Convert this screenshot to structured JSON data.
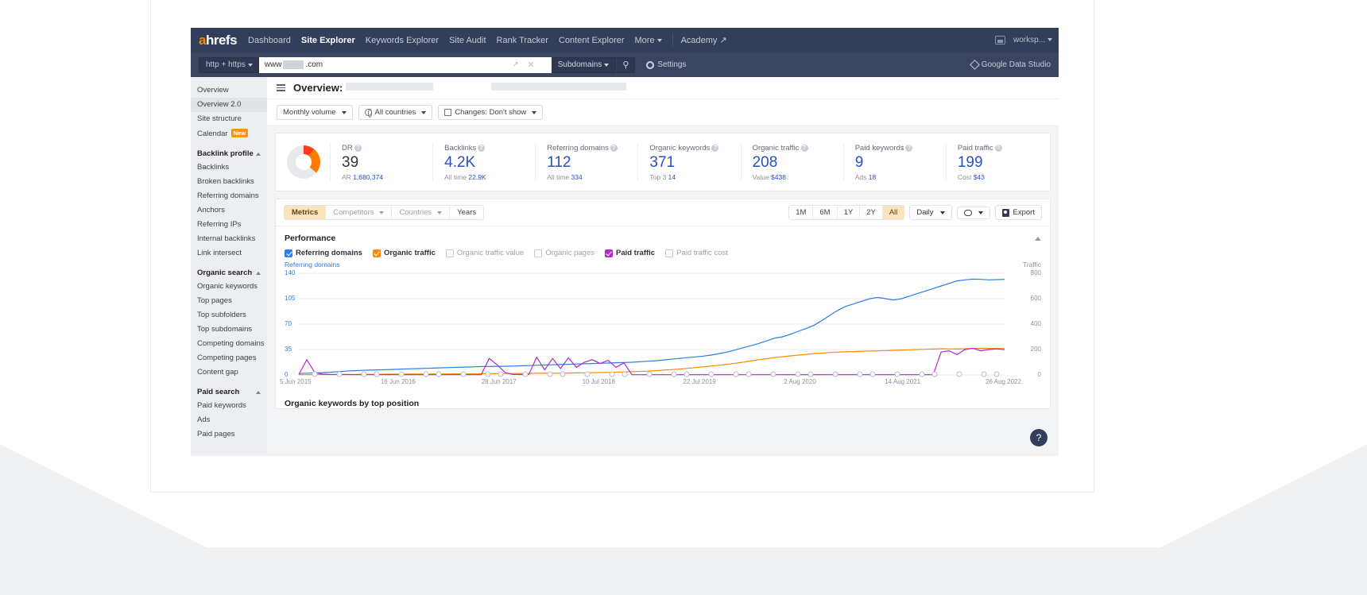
{
  "topnav": {
    "logo": "ahrefs",
    "items": [
      {
        "label": "Dashboard",
        "active": false
      },
      {
        "label": "Site Explorer",
        "active": true
      },
      {
        "label": "Keywords Explorer",
        "active": false
      },
      {
        "label": "Site Audit",
        "active": false
      },
      {
        "label": "Rank Tracker",
        "active": false
      },
      {
        "label": "Content Explorer",
        "active": false
      },
      {
        "label": "More",
        "active": false
      }
    ],
    "academy": "Academy",
    "workspace": "worksp..."
  },
  "searchbar": {
    "protocol": "http + https",
    "value_prefix": "www",
    "value_suffix": ".com",
    "scope": "Subdomains",
    "settings": "Settings",
    "data_studio": "Google Data Studio"
  },
  "sidebar": {
    "items": [
      {
        "label": "Overview",
        "type": "item",
        "selected": false
      },
      {
        "label": "Overview 2.0",
        "type": "item",
        "selected": true
      },
      {
        "label": "Site structure",
        "type": "item",
        "selected": false
      },
      {
        "label": "Calendar",
        "type": "item",
        "selected": false,
        "badge": "New"
      },
      {
        "label": "Backlink profile",
        "type": "group"
      },
      {
        "label": "Backlinks",
        "type": "item",
        "selected": false
      },
      {
        "label": "Broken backlinks",
        "type": "item",
        "selected": false
      },
      {
        "label": "Referring domains",
        "type": "item",
        "selected": false
      },
      {
        "label": "Anchors",
        "type": "item",
        "selected": false
      },
      {
        "label": "Referring IPs",
        "type": "item",
        "selected": false
      },
      {
        "label": "Internal backlinks",
        "type": "item",
        "selected": false
      },
      {
        "label": "Link intersect",
        "type": "item",
        "selected": false
      },
      {
        "label": "Organic search",
        "type": "group"
      },
      {
        "label": "Organic keywords",
        "type": "item",
        "selected": false
      },
      {
        "label": "Top pages",
        "type": "item",
        "selected": false
      },
      {
        "label": "Top subfolders",
        "type": "item",
        "selected": false
      },
      {
        "label": "Top subdomains",
        "type": "item",
        "selected": false
      },
      {
        "label": "Competing domains",
        "type": "item",
        "selected": false
      },
      {
        "label": "Competing pages",
        "type": "item",
        "selected": false
      },
      {
        "label": "Content gap",
        "type": "item",
        "selected": false
      },
      {
        "label": "Paid search",
        "type": "group"
      },
      {
        "label": "Paid keywords",
        "type": "item",
        "selected": false
      },
      {
        "label": "Ads",
        "type": "item",
        "selected": false
      },
      {
        "label": "Paid pages",
        "type": "item",
        "selected": false
      }
    ]
  },
  "page": {
    "title": "Overview:"
  },
  "filters": [
    {
      "label": "Monthly volume",
      "icon": null
    },
    {
      "label": "All countries",
      "icon": "globe-icon"
    },
    {
      "label": "Changes: Don't show",
      "icon": "calendar-icon"
    }
  ],
  "metrics": {
    "dr_gauge_value": 39,
    "cards": [
      {
        "label": "DR",
        "value": "39",
        "value_dark": true,
        "sub_label": "AR",
        "sub_value": "1,680,374"
      },
      {
        "label": "Backlinks",
        "value": "4.2K",
        "value_dark": false,
        "sub_label": "All time",
        "sub_value": "22.9K"
      },
      {
        "label": "Referring domains",
        "value": "112",
        "value_dark": false,
        "sub_label": "All time",
        "sub_value": "334"
      },
      {
        "label": "Organic keywords",
        "value": "371",
        "value_dark": false,
        "sub_label": "Top 3",
        "sub_value": "14"
      },
      {
        "label": "Organic traffic",
        "value": "208",
        "value_dark": false,
        "sub_label": "Value",
        "sub_value": "$438"
      },
      {
        "label": "Paid keywords",
        "value": "9",
        "value_dark": false,
        "sub_label": "Ads",
        "sub_value": "18"
      },
      {
        "label": "Paid traffic",
        "value": "199",
        "value_dark": false,
        "sub_label": "Cost",
        "sub_value": "$43"
      }
    ]
  },
  "chart_toolbar": {
    "tabs": [
      {
        "label": "Metrics",
        "state": "active"
      },
      {
        "label": "Competitors",
        "state": "muted",
        "caret": true
      },
      {
        "label": "Countries",
        "state": "muted",
        "caret": true
      },
      {
        "label": "Years",
        "state": "normal"
      }
    ],
    "ranges": [
      {
        "label": "1M",
        "on": false
      },
      {
        "label": "6M",
        "on": false
      },
      {
        "label": "1Y",
        "on": false
      },
      {
        "label": "2Y",
        "on": false
      },
      {
        "label": "All",
        "on": true
      }
    ],
    "granularity": "Daily",
    "export": "Export"
  },
  "performance": {
    "title": "Performance",
    "legend": [
      {
        "label": "Referring domains",
        "checked": true,
        "color": "#2b7de9"
      },
      {
        "label": "Organic traffic",
        "checked": true,
        "color": "#ff8800"
      },
      {
        "label": "Organic traffic value",
        "checked": false,
        "color": "#cccccc"
      },
      {
        "label": "Organic pages",
        "checked": false,
        "color": "#cccccc"
      },
      {
        "label": "Paid traffic",
        "checked": true,
        "color": "#b02ad0"
      },
      {
        "label": "Paid traffic cost",
        "checked": false,
        "color": "#cccccc"
      }
    ],
    "left_axis_title": "Referring domains",
    "right_axis_title": "Traffic"
  },
  "below_section_title": "Organic keywords by top position",
  "help_button": "?",
  "chart_data": {
    "type": "line",
    "title": "Performance",
    "xlabel": "",
    "ylabel": "Referring domains",
    "y2label": "Traffic",
    "grid": true,
    "legend_position": "top",
    "x_ticks": [
      "5 Jun 2015",
      "16 Jun 2016",
      "28 Jun 2017",
      "10 Jul 2018",
      "22 Jul 2019",
      "2 Aug 2020",
      "14 Aug 2021",
      "26 Aug 2022"
    ],
    "y_ticks_left": [
      0,
      35,
      70,
      105,
      140
    ],
    "y_ticks_right": [
      0,
      200,
      400,
      600,
      800
    ],
    "ylim_left": [
      0,
      140
    ],
    "ylim_right": [
      0,
      800
    ],
    "series": [
      {
        "name": "Referring domains",
        "color": "#2b7de9",
        "axis": "right",
        "values": [
          12,
          14,
          16,
          18,
          22,
          26,
          30,
          34,
          36,
          38,
          40,
          42,
          44,
          46,
          48,
          50,
          52,
          54,
          56,
          58,
          60,
          62,
          64,
          66,
          66,
          68,
          68,
          70,
          72,
          74,
          76,
          78,
          80,
          82,
          84,
          86,
          88,
          90,
          92,
          94,
          96,
          98,
          100,
          104,
          108,
          112,
          118,
          124,
          130,
          136,
          142,
          148,
          156,
          168,
          180,
          196,
          214,
          230,
          248,
          268,
          290,
          300,
          320,
          344,
          366,
          392,
          430,
          470,
          510,
          540,
          560,
          580,
          600,
          610,
          600,
          590,
          600,
          620,
          640,
          660,
          680,
          700,
          720,
          740,
          748,
          754,
          752,
          748,
          750,
          752
        ]
      },
      {
        "name": "Organic traffic",
        "color": "#ff8800",
        "axis": "right",
        "values": [
          2,
          2,
          3,
          3,
          3,
          4,
          4,
          4,
          5,
          5,
          5,
          6,
          6,
          6,
          7,
          7,
          7,
          8,
          8,
          8,
          9,
          9,
          9,
          10,
          10,
          10,
          11,
          11,
          12,
          12,
          13,
          13,
          14,
          14,
          15,
          16,
          17,
          18,
          19,
          20,
          22,
          24,
          26,
          28,
          30,
          34,
          38,
          42,
          46,
          52,
          58,
          64,
          70,
          76,
          84,
          92,
          100,
          110,
          120,
          128,
          136,
          144,
          150,
          156,
          162,
          168,
          172,
          176,
          180,
          182,
          184,
          186,
          188,
          190,
          192,
          194,
          196,
          198,
          200,
          202,
          204,
          206,
          205,
          204,
          206,
          208,
          210,
          209,
          208,
          208
        ]
      },
      {
        "name": "Paid traffic",
        "color": "#b02ad0",
        "axis": "right",
        "values": [
          4,
          120,
          20,
          6,
          4,
          3,
          3,
          2,
          2,
          2,
          2,
          2,
          2,
          2,
          2,
          2,
          2,
          2,
          2,
          2,
          2,
          2,
          2,
          2,
          130,
          80,
          20,
          4,
          3,
          3,
          140,
          40,
          130,
          50,
          135,
          60,
          100,
          120,
          90,
          115,
          60,
          95,
          2,
          2,
          2,
          2,
          2,
          2,
          2,
          2,
          2,
          2,
          2,
          2,
          2,
          2,
          2,
          2,
          2,
          2,
          2,
          2,
          2,
          2,
          2,
          2,
          2,
          2,
          2,
          2,
          2,
          2,
          2,
          2,
          2,
          2,
          2,
          2,
          2,
          2,
          2,
          180,
          190,
          160,
          200,
          210,
          190,
          200,
          205,
          199
        ]
      }
    ]
  }
}
